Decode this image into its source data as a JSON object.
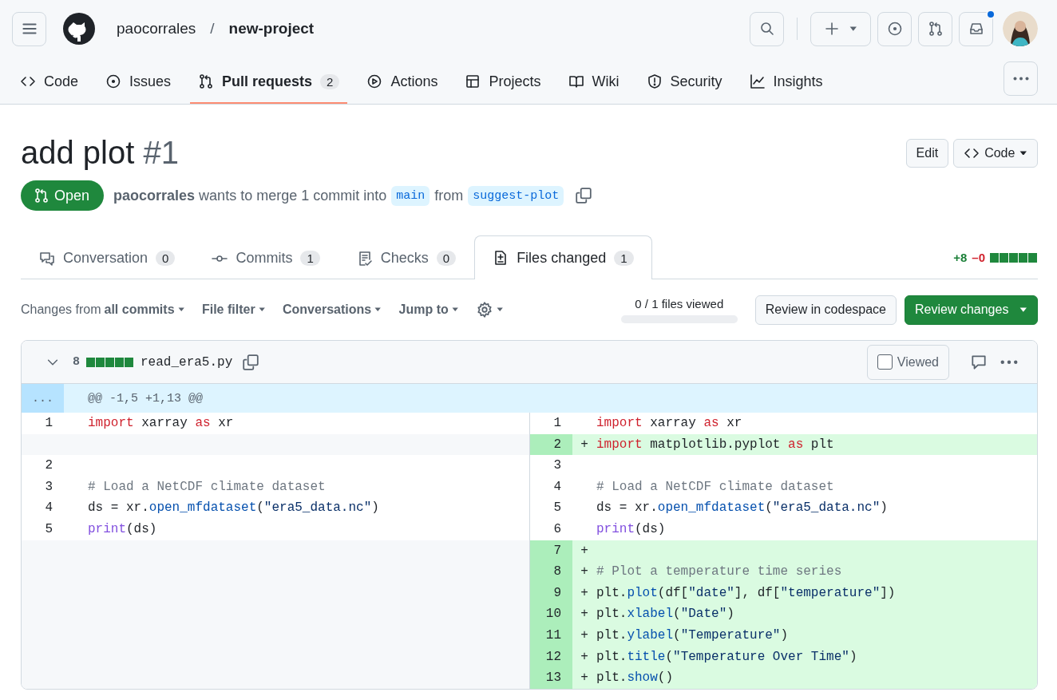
{
  "header": {
    "owner": "paocorrales",
    "separator": "/",
    "repo": "new-project",
    "notification": true
  },
  "repo_tabs": [
    {
      "label": "Code",
      "selected": false
    },
    {
      "label": "Issues",
      "selected": false
    },
    {
      "label": "Pull requests",
      "count": "2",
      "selected": true
    },
    {
      "label": "Actions",
      "selected": false
    },
    {
      "label": "Projects",
      "selected": false
    },
    {
      "label": "Wiki",
      "selected": false
    },
    {
      "label": "Security",
      "selected": false
    },
    {
      "label": "Insights",
      "selected": false
    }
  ],
  "pr": {
    "title": "add plot",
    "number": "#1",
    "state": "Open",
    "author": "paocorrales",
    "summary": "wants to merge 1 commit into",
    "base": "main",
    "from": "from",
    "head": "suggest-plot",
    "edit": "Edit",
    "code": "Code"
  },
  "pr_tabs": [
    {
      "label": "Conversation",
      "count": "0",
      "selected": false
    },
    {
      "label": "Commits",
      "count": "1",
      "selected": false
    },
    {
      "label": "Checks",
      "count": "0",
      "selected": false
    },
    {
      "label": "Files changed",
      "count": "1",
      "selected": true
    }
  ],
  "diff_stats": {
    "additions": "+8",
    "deletions": "–0"
  },
  "toolbar": {
    "changes_prefix": "Changes from",
    "changes_value": "all commits",
    "filters": [
      "File filter",
      "Conversations",
      "Jump to"
    ],
    "progress": {
      "label": "0 / 1 files viewed",
      "level": 0
    },
    "review_codespace": "Review in codespace",
    "review_changes": "Review changes"
  },
  "file": {
    "expanded": true,
    "changes": "8",
    "name": "read_era5.py",
    "viewed_label": "Viewed",
    "viewed": false,
    "hunk_marker": "...",
    "hunk_header": "@@ -1,5 +1,13 @@",
    "rows": [
      {
        "left": {
          "num": "1",
          "kind": "context",
          "tokens": [
            {
              "kind": "kw",
              "text": "import"
            },
            {
              "kind": "plain",
              "text": " xarray "
            },
            {
              "kind": "kw",
              "text": "as"
            },
            {
              "kind": "plain",
              "text": " xr"
            }
          ]
        },
        "right": {
          "num": "1",
          "kind": "context",
          "tokens": [
            {
              "kind": "kw",
              "text": "import"
            },
            {
              "kind": "plain",
              "text": " xarray "
            },
            {
              "kind": "kw",
              "text": "as"
            },
            {
              "kind": "plain",
              "text": " xr"
            }
          ]
        }
      },
      {
        "left": {
          "kind": "empty"
        },
        "right": {
          "num": "2",
          "kind": "added",
          "marker": "+",
          "tokens": [
            {
              "kind": "kw",
              "text": "import"
            },
            {
              "kind": "plain",
              "text": " matplotlib.pyplot "
            },
            {
              "kind": "kw",
              "text": "as"
            },
            {
              "kind": "plain",
              "text": " plt"
            }
          ]
        }
      },
      {
        "left": {
          "num": "2",
          "kind": "context"
        },
        "right": {
          "num": "3",
          "kind": "context"
        }
      },
      {
        "left": {
          "num": "3",
          "kind": "context",
          "tokens": [
            {
              "kind": "com",
              "text": "# Load a NetCDF climate dataset"
            }
          ]
        },
        "right": {
          "num": "4",
          "kind": "context",
          "tokens": [
            {
              "kind": "com",
              "text": "# Load a NetCDF climate dataset"
            }
          ]
        }
      },
      {
        "left": {
          "num": "4",
          "kind": "context",
          "tokens": [
            {
              "kind": "plain",
              "text": "ds = xr."
            },
            {
              "kind": "call",
              "text": "open_mfdataset"
            },
            {
              "kind": "plain",
              "text": "("
            },
            {
              "kind": "str",
              "text": "\"era5_data.nc\""
            },
            {
              "kind": "plain",
              "text": ")"
            }
          ]
        },
        "right": {
          "num": "5",
          "kind": "context",
          "tokens": [
            {
              "kind": "plain",
              "text": "ds = xr."
            },
            {
              "kind": "call",
              "text": "open_mfdataset"
            },
            {
              "kind": "plain",
              "text": "("
            },
            {
              "kind": "str",
              "text": "\"era5_data.nc\""
            },
            {
              "kind": "plain",
              "text": ")"
            }
          ]
        }
      },
      {
        "left": {
          "num": "5",
          "kind": "context",
          "tokens": [
            {
              "kind": "builtin",
              "text": "print"
            },
            {
              "kind": "plain",
              "text": "(ds)"
            }
          ]
        },
        "right": {
          "num": "6",
          "kind": "context",
          "tokens": [
            {
              "kind": "builtin",
              "text": "print"
            },
            {
              "kind": "plain",
              "text": "(ds)"
            }
          ]
        }
      },
      {
        "left": {
          "kind": "empty"
        },
        "right": {
          "num": "7",
          "kind": "added",
          "marker": "+"
        }
      },
      {
        "left": {
          "kind": "empty"
        },
        "right": {
          "num": "8",
          "kind": "added",
          "marker": "+",
          "tokens": [
            {
              "kind": "com",
              "text": "# Plot a temperature time series"
            }
          ]
        }
      },
      {
        "left": {
          "kind": "empty"
        },
        "right": {
          "num": "9",
          "kind": "added",
          "marker": "+",
          "tokens": [
            {
              "kind": "plain",
              "text": "plt."
            },
            {
              "kind": "call",
              "text": "plot"
            },
            {
              "kind": "plain",
              "text": "(df["
            },
            {
              "kind": "str",
              "text": "\"date\""
            },
            {
              "kind": "plain",
              "text": "], df["
            },
            {
              "kind": "str",
              "text": "\"temperature\""
            },
            {
              "kind": "plain",
              "text": "])"
            }
          ]
        }
      },
      {
        "left": {
          "kind": "empty"
        },
        "right": {
          "num": "10",
          "kind": "added",
          "marker": "+",
          "tokens": [
            {
              "kind": "plain",
              "text": "plt."
            },
            {
              "kind": "call",
              "text": "xlabel"
            },
            {
              "kind": "plain",
              "text": "("
            },
            {
              "kind": "str",
              "text": "\"Date\""
            },
            {
              "kind": "plain",
              "text": ")"
            }
          ]
        }
      },
      {
        "left": {
          "kind": "empty"
        },
        "right": {
          "num": "11",
          "kind": "added",
          "marker": "+",
          "tokens": [
            {
              "kind": "plain",
              "text": "plt."
            },
            {
              "kind": "call",
              "text": "ylabel"
            },
            {
              "kind": "plain",
              "text": "("
            },
            {
              "kind": "str",
              "text": "\"Temperature\""
            },
            {
              "kind": "plain",
              "text": ")"
            }
          ]
        }
      },
      {
        "left": {
          "kind": "empty"
        },
        "right": {
          "num": "12",
          "kind": "added",
          "marker": "+",
          "tokens": [
            {
              "kind": "plain",
              "text": "plt."
            },
            {
              "kind": "call",
              "text": "title"
            },
            {
              "kind": "plain",
              "text": "("
            },
            {
              "kind": "str",
              "text": "\"Temperature Over Time\""
            },
            {
              "kind": "plain",
              "text": ")"
            }
          ]
        }
      },
      {
        "left": {
          "kind": "empty"
        },
        "right": {
          "num": "13",
          "kind": "added",
          "marker": "+",
          "tokens": [
            {
              "kind": "plain",
              "text": "plt."
            },
            {
              "kind": "call",
              "text": "show"
            },
            {
              "kind": "plain",
              "text": "()"
            }
          ]
        }
      }
    ]
  }
}
